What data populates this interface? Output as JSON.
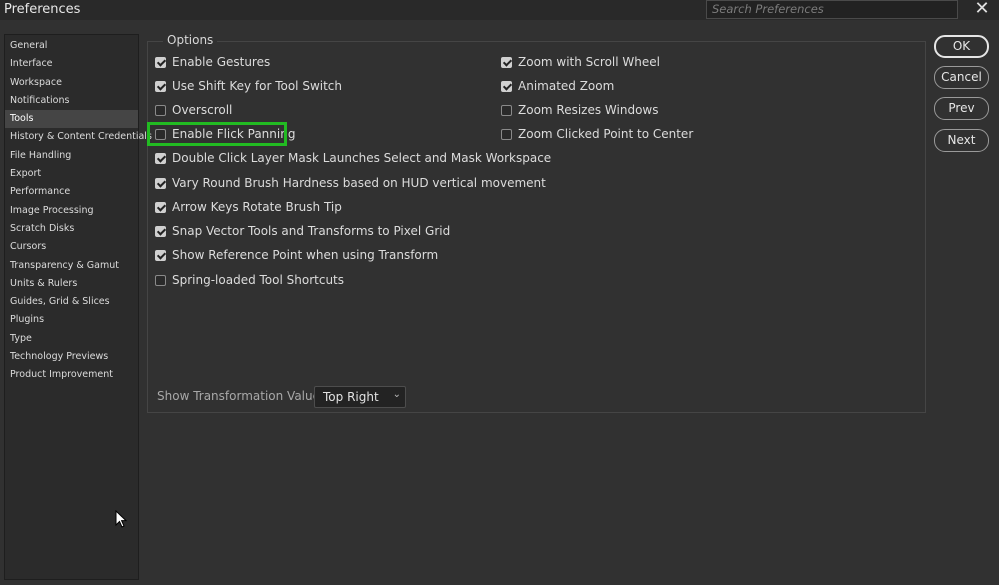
{
  "window": {
    "title": "Preferences",
    "search_placeholder": "Search Preferences"
  },
  "sidebar": {
    "items": [
      {
        "label": "General"
      },
      {
        "label": "Interface"
      },
      {
        "label": "Workspace"
      },
      {
        "label": "Notifications"
      },
      {
        "label": "Tools",
        "active": true
      },
      {
        "label": "History & Content Credentials"
      },
      {
        "label": "File Handling"
      },
      {
        "label": "Export"
      },
      {
        "label": "Performance"
      },
      {
        "label": "Image Processing"
      },
      {
        "label": "Scratch Disks"
      },
      {
        "label": "Cursors"
      },
      {
        "label": "Transparency & Gamut"
      },
      {
        "label": "Units & Rulers"
      },
      {
        "label": "Guides, Grid & Slices"
      },
      {
        "label": "Plugins"
      },
      {
        "label": "Type"
      },
      {
        "label": "Technology Previews"
      },
      {
        "label": "Product Improvement"
      }
    ]
  },
  "options": {
    "legend": "Options",
    "left": [
      {
        "label": "Enable Gestures",
        "checked": true
      },
      {
        "label": "Use Shift Key for Tool Switch",
        "checked": true
      },
      {
        "label": "Overscroll",
        "checked": false
      },
      {
        "label": "Enable Flick Panning",
        "checked": false
      },
      {
        "label": "Double Click Layer Mask Launches Select and Mask Workspace",
        "checked": true
      },
      {
        "label": "Vary Round Brush Hardness based on HUD vertical movement",
        "checked": true
      },
      {
        "label": "Arrow Keys Rotate Brush Tip",
        "checked": true
      },
      {
        "label": "Snap Vector Tools and Transforms to Pixel Grid",
        "checked": true
      },
      {
        "label": "Show Reference Point when using Transform",
        "checked": true
      },
      {
        "label": "Spring-loaded Tool Shortcuts",
        "checked": false
      }
    ],
    "right": [
      {
        "label": "Zoom with Scroll Wheel",
        "checked": true
      },
      {
        "label": "Animated Zoom",
        "checked": true
      },
      {
        "label": "Zoom Resizes Windows",
        "checked": false
      },
      {
        "label": "Zoom Clicked Point to Center",
        "checked": false
      }
    ],
    "transform_values_label": "Show Transformation Values:",
    "transform_values_selected": "Top Right"
  },
  "buttons": {
    "ok": "OK",
    "cancel": "Cancel",
    "prev": "Prev",
    "next": "Next"
  },
  "colors": {
    "highlight": "#22bb22",
    "background": "#313131"
  }
}
